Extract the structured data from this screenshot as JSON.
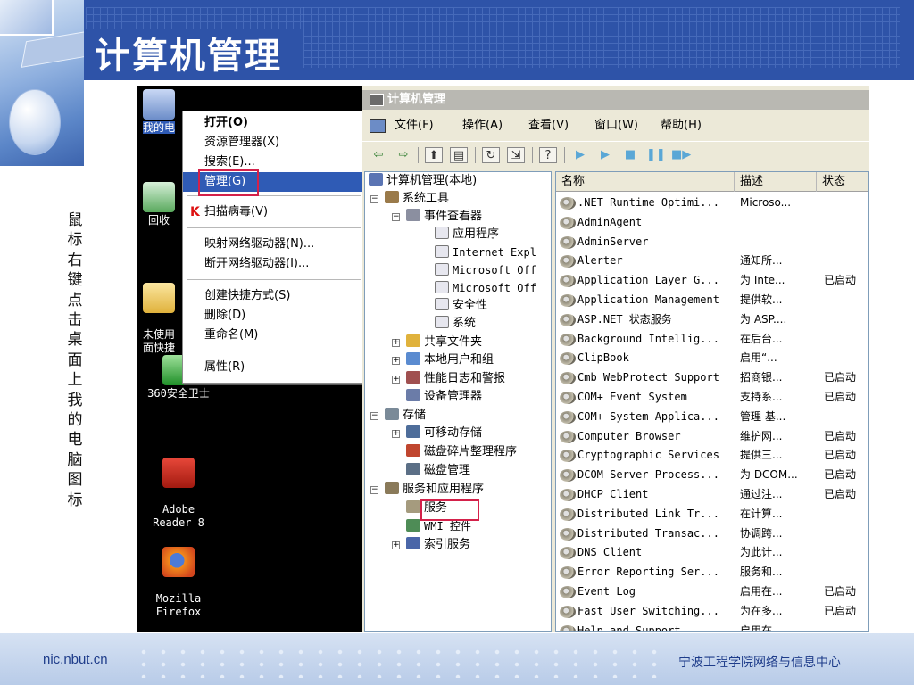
{
  "slide": {
    "title": "计算机管理",
    "caption": "鼠标右键点击桌面上我的电脑图标",
    "footer_left": "nic.nbut.cn",
    "footer_right": "宁波工程学院网络与信息中心"
  },
  "desktop": {
    "icons": [
      {
        "label": "我的电",
        "icon": "my-computer-icon"
      },
      {
        "label": "回收",
        "icon": "recycle-bin-icon"
      },
      {
        "label": "未使用\n面快捷",
        "icon": "folder-icon"
      },
      {
        "label": "360安全卫士",
        "icon": "360-safeguard-icon"
      },
      {
        "label": "Adobe\nReader 8",
        "icon": "adobe-reader-icon"
      },
      {
        "label": "Mozilla\nFirefox",
        "icon": "firefox-icon"
      }
    ]
  },
  "context_menu": {
    "items": [
      {
        "label": "打开(O)"
      },
      {
        "label": "资源管理器(X)"
      },
      {
        "label": "搜索(E)..."
      },
      {
        "label": "管理(G)"
      },
      {
        "label": "扫描病毒(V)"
      },
      {
        "label": "映射网络驱动器(N)..."
      },
      {
        "label": "断开网络驱动器(I)..."
      },
      {
        "label": "创建快捷方式(S)"
      },
      {
        "label": "删除(D)"
      },
      {
        "label": "重命名(M)"
      },
      {
        "label": "属性(R)"
      }
    ]
  },
  "window": {
    "title": "计算机管理",
    "menus": [
      "文件(F)",
      "操作(A)",
      "查看(V)",
      "窗口(W)",
      "帮助(H)"
    ]
  },
  "tree": {
    "root": "计算机管理(本地)",
    "nodes": [
      {
        "label": "系统工具"
      },
      {
        "label": "事件查看器"
      },
      {
        "label": "应用程序"
      },
      {
        "label": "Internet Expl"
      },
      {
        "label": "Microsoft Off"
      },
      {
        "label": "Microsoft Off"
      },
      {
        "label": "安全性"
      },
      {
        "label": "系统"
      },
      {
        "label": "共享文件夹"
      },
      {
        "label": "本地用户和组"
      },
      {
        "label": "性能日志和警报"
      },
      {
        "label": "设备管理器"
      },
      {
        "label": "存储"
      },
      {
        "label": "可移动存储"
      },
      {
        "label": "磁盘碎片整理程序"
      },
      {
        "label": "磁盘管理"
      },
      {
        "label": "服务和应用程序"
      },
      {
        "label": "服务"
      },
      {
        "label": "WMI 控件"
      },
      {
        "label": "索引服务"
      }
    ]
  },
  "list": {
    "columns": [
      "名称",
      "描述",
      "状态"
    ],
    "rows": [
      {
        "name": ".NET Runtime Optimi...",
        "desc": "Microso...",
        "status": ""
      },
      {
        "name": "AdminAgent",
        "desc": "",
        "status": ""
      },
      {
        "name": "AdminServer",
        "desc": "",
        "status": ""
      },
      {
        "name": "Alerter",
        "desc": "通知所...",
        "status": ""
      },
      {
        "name": "Application Layer G...",
        "desc": "为 Inte...",
        "status": "已启动"
      },
      {
        "name": "Application Management",
        "desc": "提供软...",
        "status": ""
      },
      {
        "name": "ASP.NET 状态服务",
        "desc": "为 ASP....",
        "status": ""
      },
      {
        "name": "Background Intellig...",
        "desc": "在后台...",
        "status": ""
      },
      {
        "name": "ClipBook",
        "desc": "启用“...",
        "status": ""
      },
      {
        "name": "Cmb WebProtect Support",
        "desc": "招商银...",
        "status": "已启动"
      },
      {
        "name": "COM+ Event System",
        "desc": "支持系...",
        "status": "已启动"
      },
      {
        "name": "COM+ System Applica...",
        "desc": "管理 基...",
        "status": ""
      },
      {
        "name": "Computer Browser",
        "desc": "维护网...",
        "status": "已启动"
      },
      {
        "name": "Cryptographic Services",
        "desc": "提供三...",
        "status": "已启动"
      },
      {
        "name": "DCOM Server Process...",
        "desc": "为 DCOM...",
        "status": "已启动"
      },
      {
        "name": "DHCP Client",
        "desc": "通过注...",
        "status": "已启动"
      },
      {
        "name": "Distributed Link Tr...",
        "desc": "在计算...",
        "status": ""
      },
      {
        "name": "Distributed Transac...",
        "desc": "协调跨...",
        "status": ""
      },
      {
        "name": "DNS Client",
        "desc": "为此计...",
        "status": ""
      },
      {
        "name": "Error Reporting Ser...",
        "desc": "服务和...",
        "status": ""
      },
      {
        "name": "Event Log",
        "desc": "启用在...",
        "status": "已启动"
      },
      {
        "name": "Fast User Switching...",
        "desc": "为在多...",
        "status": "已启动"
      },
      {
        "name": "Help and Support",
        "desc": "启用在...",
        "status": ""
      }
    ]
  }
}
